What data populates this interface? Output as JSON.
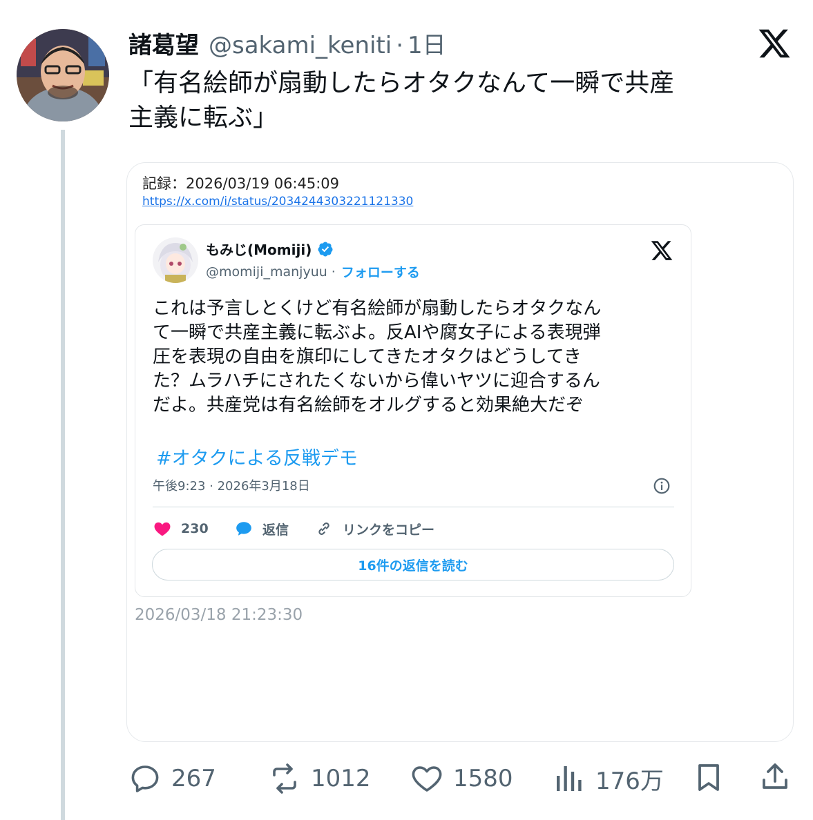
{
  "author": {
    "name": "諸葛望",
    "handle": "@sakami_keniti",
    "separator": "·",
    "time_ago": "1日"
  },
  "tweet": {
    "lines": [
      "「有名絵師が扇動したらオタクなんて一瞬で共産",
      "主義に転ぶ」"
    ]
  },
  "capture": {
    "record_label": "記録：2026/03/19 06:45:09",
    "url": "https://x.com/i/status/2034244303221121330",
    "footer_timestamp": "2026/03/18 21:23:30"
  },
  "embed": {
    "name": "もみじ(Momiji)",
    "handle": "@momiji_manjyuu",
    "separator": "·",
    "follow_label": "フォローする",
    "body_lines": [
      "これは予言しとくけど有名絵師が扇動したらオタクなん",
      "て一瞬で共産主義に転ぶよ。反AIや腐女子による表現弾",
      "圧を表現の自由を旗印にしてきたオタクはどうしてき",
      "た？ムラハチにされたくないから偉いヤツに迎合するん",
      "だよ。共産党は有名絵師をオルグすると効果絶大だぞ"
    ],
    "hashtag": "#オタクによる反戦デモ",
    "meta": "午後9:23 · 2026年3月18日",
    "likes": "230",
    "reply_label": "返信",
    "copy_link_label": "リンクをコピー",
    "read_replies_label": "16件の返信を読む",
    "like_color": "#f91880",
    "accent_color": "#1d9bf0"
  },
  "stats": {
    "replies": "267",
    "retweets": "1012",
    "likes": "1580",
    "views": "176万"
  },
  "icons": {
    "x_logo": "x-logo-icon",
    "verified": "verified-badge-icon",
    "info": "info-icon",
    "reply": "comment-icon",
    "retweet": "retweet-icon",
    "like": "heart-icon",
    "views": "views-chart-icon",
    "bookmark": "bookmark-icon",
    "share": "share-icon"
  }
}
